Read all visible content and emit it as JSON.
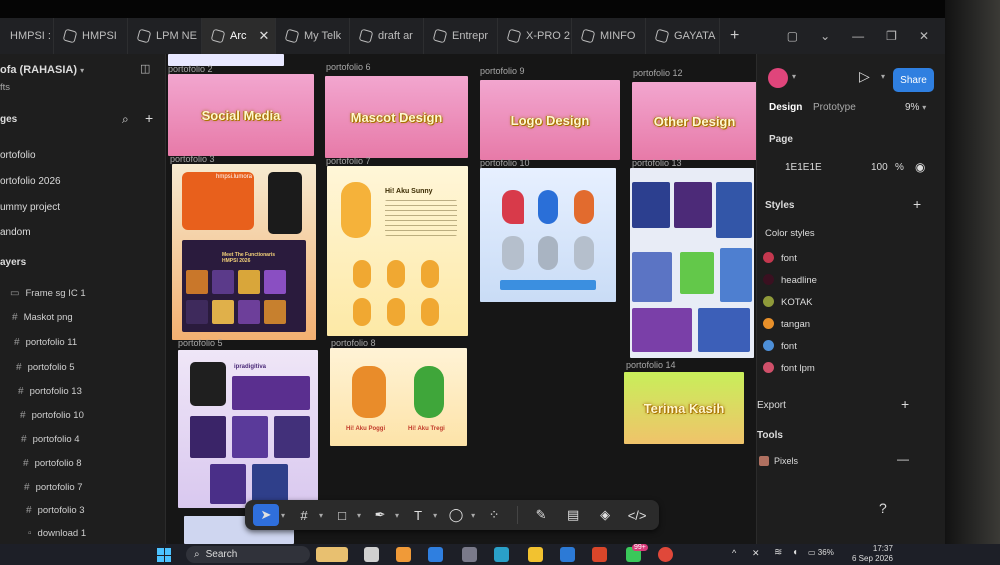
{
  "tabs": [
    {
      "label": "HMPSI :",
      "active": false
    },
    {
      "label": "HMPSI",
      "active": false
    },
    {
      "label": "LPM NE",
      "active": false
    },
    {
      "label": "Arc",
      "active": true
    },
    {
      "label": "My Telk",
      "active": false
    },
    {
      "label": "draft ar",
      "active": false
    },
    {
      "label": "Entrepr",
      "active": false
    },
    {
      "label": "X-PRO 2",
      "active": false
    },
    {
      "label": "MINFO",
      "active": false
    },
    {
      "label": "GAYATA",
      "active": false
    }
  ],
  "new_tab": "+",
  "file": {
    "title": "ofa (RAHASIA)",
    "subtitle": "fts"
  },
  "pages": {
    "header": "ges",
    "items": [
      "ortofolio",
      "ortofolio 2026",
      "ummy project",
      "andom"
    ]
  },
  "layers": {
    "header": "ayers",
    "items": [
      "Frame sg IC 1",
      "Maskot png",
      "portofolio 11",
      "portofolio 5",
      "portofolio 13",
      "portofolio 10",
      "portofolio 4",
      "portofolio 8",
      "portofolio 7",
      "portofolio 3",
      "download 1"
    ]
  },
  "canvas": {
    "frame_labels": [
      "portofolio 2",
      "portofolio 6",
      "portofolio 9",
      "portofolio 12",
      "portofolio 3",
      "portofolio 7",
      "portofolio 10",
      "portofolio 13",
      "portofolio 5",
      "portofolio 8",
      "portofolio 14"
    ],
    "frame_titles": [
      "Social Media",
      "Mascot Design",
      "Logo Design",
      "Other Design",
      "Terima Kasih"
    ],
    "inner_text": [
      "hmpsi.lumora",
      "Meet The Functionaris HMPSI 2026",
      "Hi! Aku Sunny",
      "ipradigitiva",
      "Hi! Aku Poggi",
      "Hi! Aku Tregi"
    ]
  },
  "right": {
    "tabs": [
      "Design",
      "Prototype"
    ],
    "zoom": "9%",
    "share": "Share",
    "page_label": "Page",
    "page_color": "1E1E1E",
    "page_opacity": "100",
    "percent": "%",
    "styles_label": "Styles",
    "color_styles_label": "Color styles",
    "color_styles": [
      {
        "name": "font",
        "color": "#c4384f"
      },
      {
        "name": "headline",
        "color": "#3a1020"
      },
      {
        "name": "KOTAK",
        "color": "#8f9a3a"
      },
      {
        "name": "tangan",
        "color": "#e8902a"
      },
      {
        "name": "font",
        "color": "#4d8fd8"
      },
      {
        "name": "font lpm",
        "color": "#d0506a"
      }
    ],
    "export_label": "Export",
    "tools_label": "Tools",
    "plugin": "Pixels",
    "help": "?",
    "avatar_color": "#e0457b"
  },
  "taskbar": {
    "search": "Search",
    "badge": "99+",
    "battery": "36%",
    "time": "17:37",
    "date": "6 Sep 2026"
  },
  "colors": {
    "accent": "#2f6fdc",
    "share": "#2f7fe0"
  }
}
